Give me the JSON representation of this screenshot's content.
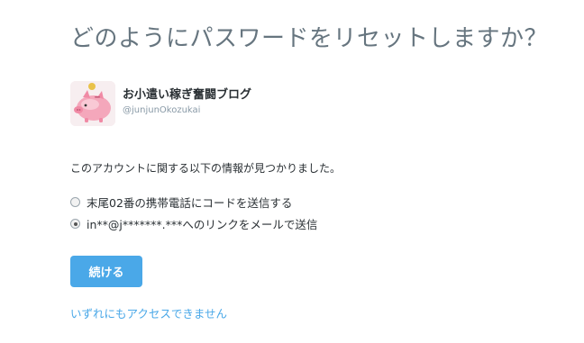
{
  "page": {
    "title": "どのようにパスワードをリセットしますか？"
  },
  "account": {
    "display_name": "お小遣い稼ぎ奮闘ブログ",
    "handle": "@junjunOkozukai",
    "avatar_icon": "pig-piggy-bank-icon"
  },
  "info_text": "このアカウントに関する以下の情報が見つかりました。",
  "options": [
    {
      "label": "末尾02番の携帯電話にコードを送信する",
      "checked": false
    },
    {
      "label": "in**@j*******.***へのリンクをメールで送信",
      "checked": true
    }
  ],
  "continue_button": {
    "label": "続ける",
    "color": "#4aa8e8"
  },
  "no_access_link": "いずれにもアクセスできません",
  "colors": {
    "title": "#66757f",
    "link": "#4aa8e8",
    "handle": "#8899a6"
  }
}
